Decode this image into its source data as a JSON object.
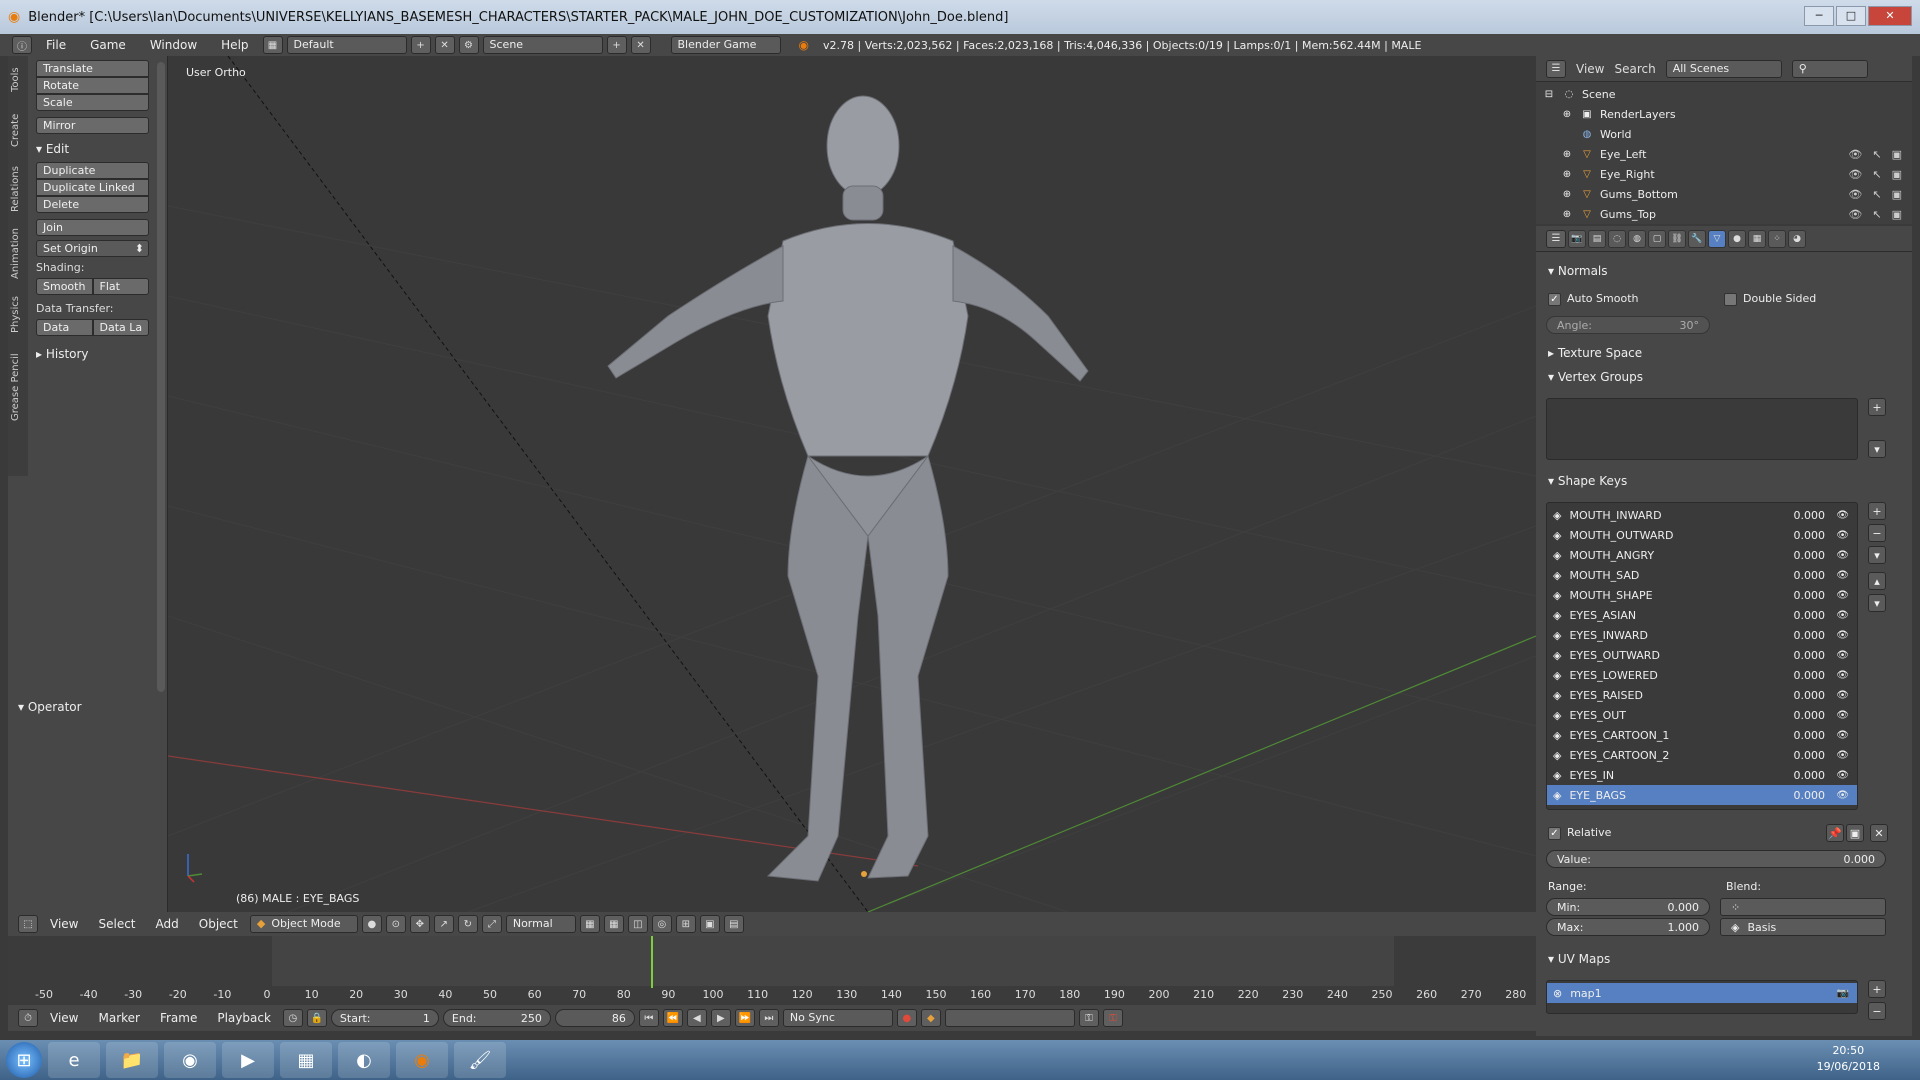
{
  "window": {
    "title": "Blender* [C:\\Users\\Ian\\Documents\\UNIVERSE\\KELLYIANS_BASEMESH_CHARACTERS\\STARTER_PACK\\MALE_JOHN_DOE_CUSTOMIZATION\\John_Doe.blend]"
  },
  "menubar": {
    "items": [
      "File",
      "Game",
      "Window",
      "Help"
    ],
    "layout": "Default",
    "scene": "Scene",
    "engine": "Blender Game",
    "stats": "v2.78 | Verts:2,023,562 | Faces:2,023,168 | Tris:4,046,336 | Objects:0/19 | Lamps:0/1 | Mem:562.44M | MALE"
  },
  "toolshelf": {
    "tabs": [
      "Tools",
      "Create",
      "Relations",
      "Animation",
      "Physics",
      "Grease Pencil"
    ],
    "transform": [
      "Translate",
      "Rotate",
      "Scale"
    ],
    "mirror": "Mirror",
    "edit_header": "Edit",
    "edit": [
      "Duplicate",
      "Duplicate Linked",
      "Delete"
    ],
    "join": "Join",
    "set_origin": "Set Origin",
    "shading_label": "Shading:",
    "smooth": "Smooth",
    "flat": "Flat",
    "data_transfer_label": "Data Transfer:",
    "data": "Data",
    "data_la": "Data La",
    "history": "History",
    "operator": "Operator"
  },
  "viewport": {
    "view_name": "User Ortho",
    "status": "(86) MALE : EYE_BAGS"
  },
  "viewport_header": {
    "items": [
      "View",
      "Select",
      "Add",
      "Object"
    ],
    "mode": "Object Mode",
    "orientation": "Normal"
  },
  "timeline": {
    "ticks": [
      "-50",
      "-40",
      "-30",
      "-20",
      "-10",
      "0",
      "10",
      "20",
      "30",
      "40",
      "50",
      "60",
      "70",
      "80",
      "90",
      "100",
      "110",
      "120",
      "130",
      "140",
      "150",
      "160",
      "170",
      "180",
      "190",
      "200",
      "210",
      "220",
      "230",
      "240",
      "250",
      "260",
      "270",
      "280"
    ],
    "menu": [
      "View",
      "Marker",
      "Frame",
      "Playback"
    ],
    "start_label": "Start:",
    "start": "1",
    "end_label": "End:",
    "end": "250",
    "current": "86",
    "sync": "No Sync"
  },
  "outliner": {
    "view": "View",
    "search": "Search",
    "filter": "All Scenes",
    "rows": [
      "Scene",
      "RenderLayers",
      "World",
      "Eye_Left",
      "Eye_Right",
      "Gums_Bottom",
      "Gums_Top"
    ]
  },
  "properties": {
    "normals": "Normals",
    "auto_smooth": "Auto Smooth",
    "double_sided": "Double Sided",
    "angle_label": "Angle:",
    "angle": "30°",
    "texture_space": "Texture Space",
    "vertex_groups": "Vertex Groups",
    "shape_keys": "Shape Keys",
    "keys": [
      {
        "name": "MOUTH_INWARD",
        "value": "0.000"
      },
      {
        "name": "MOUTH_OUTWARD",
        "value": "0.000"
      },
      {
        "name": "MOUTH_ANGRY",
        "value": "0.000"
      },
      {
        "name": "MOUTH_SAD",
        "value": "0.000"
      },
      {
        "name": "MOUTH_SHAPE",
        "value": "0.000"
      },
      {
        "name": "EYES_ASIAN",
        "value": "0.000"
      },
      {
        "name": "EYES_INWARD",
        "value": "0.000"
      },
      {
        "name": "EYES_OUTWARD",
        "value": "0.000"
      },
      {
        "name": "EYES_LOWERED",
        "value": "0.000"
      },
      {
        "name": "EYES_RAISED",
        "value": "0.000"
      },
      {
        "name": "EYES_OUT",
        "value": "0.000"
      },
      {
        "name": "EYES_CARTOON_1",
        "value": "0.000"
      },
      {
        "name": "EYES_CARTOON_2",
        "value": "0.000"
      },
      {
        "name": "EYES_IN",
        "value": "0.000"
      },
      {
        "name": "EYE_BAGS",
        "value": "0.000"
      }
    ],
    "relative": "Relative",
    "value_label": "Value:",
    "value": "0.000",
    "range_label": "Range:",
    "blend_label": "Blend:",
    "min_label": "Min:",
    "min": "0.000",
    "max_label": "Max:",
    "max": "1.000",
    "basis": "Basis",
    "uv_maps": "UV Maps",
    "uv_map": "map1"
  },
  "taskbar": {
    "time": "20:50",
    "date": "19/06/2018"
  }
}
